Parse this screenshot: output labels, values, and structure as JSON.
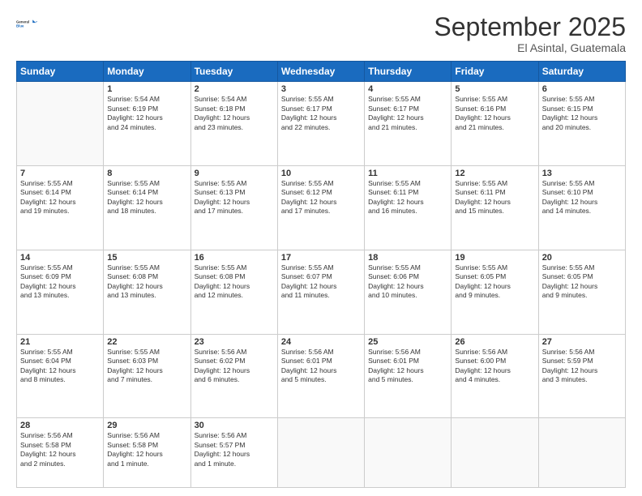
{
  "logo": {
    "line1": "General",
    "line2": "Blue"
  },
  "title": "September 2025",
  "location": "El Asintal, Guatemala",
  "days_of_week": [
    "Sunday",
    "Monday",
    "Tuesday",
    "Wednesday",
    "Thursday",
    "Friday",
    "Saturday"
  ],
  "weeks": [
    [
      {
        "day": "",
        "detail": ""
      },
      {
        "day": "1",
        "detail": "Sunrise: 5:54 AM\nSunset: 6:19 PM\nDaylight: 12 hours\nand 24 minutes."
      },
      {
        "day": "2",
        "detail": "Sunrise: 5:54 AM\nSunset: 6:18 PM\nDaylight: 12 hours\nand 23 minutes."
      },
      {
        "day": "3",
        "detail": "Sunrise: 5:55 AM\nSunset: 6:17 PM\nDaylight: 12 hours\nand 22 minutes."
      },
      {
        "day": "4",
        "detail": "Sunrise: 5:55 AM\nSunset: 6:17 PM\nDaylight: 12 hours\nand 21 minutes."
      },
      {
        "day": "5",
        "detail": "Sunrise: 5:55 AM\nSunset: 6:16 PM\nDaylight: 12 hours\nand 21 minutes."
      },
      {
        "day": "6",
        "detail": "Sunrise: 5:55 AM\nSunset: 6:15 PM\nDaylight: 12 hours\nand 20 minutes."
      }
    ],
    [
      {
        "day": "7",
        "detail": "Sunrise: 5:55 AM\nSunset: 6:14 PM\nDaylight: 12 hours\nand 19 minutes."
      },
      {
        "day": "8",
        "detail": "Sunrise: 5:55 AM\nSunset: 6:14 PM\nDaylight: 12 hours\nand 18 minutes."
      },
      {
        "day": "9",
        "detail": "Sunrise: 5:55 AM\nSunset: 6:13 PM\nDaylight: 12 hours\nand 17 minutes."
      },
      {
        "day": "10",
        "detail": "Sunrise: 5:55 AM\nSunset: 6:12 PM\nDaylight: 12 hours\nand 17 minutes."
      },
      {
        "day": "11",
        "detail": "Sunrise: 5:55 AM\nSunset: 6:11 PM\nDaylight: 12 hours\nand 16 minutes."
      },
      {
        "day": "12",
        "detail": "Sunrise: 5:55 AM\nSunset: 6:11 PM\nDaylight: 12 hours\nand 15 minutes."
      },
      {
        "day": "13",
        "detail": "Sunrise: 5:55 AM\nSunset: 6:10 PM\nDaylight: 12 hours\nand 14 minutes."
      }
    ],
    [
      {
        "day": "14",
        "detail": "Sunrise: 5:55 AM\nSunset: 6:09 PM\nDaylight: 12 hours\nand 13 minutes."
      },
      {
        "day": "15",
        "detail": "Sunrise: 5:55 AM\nSunset: 6:08 PM\nDaylight: 12 hours\nand 13 minutes."
      },
      {
        "day": "16",
        "detail": "Sunrise: 5:55 AM\nSunset: 6:08 PM\nDaylight: 12 hours\nand 12 minutes."
      },
      {
        "day": "17",
        "detail": "Sunrise: 5:55 AM\nSunset: 6:07 PM\nDaylight: 12 hours\nand 11 minutes."
      },
      {
        "day": "18",
        "detail": "Sunrise: 5:55 AM\nSunset: 6:06 PM\nDaylight: 12 hours\nand 10 minutes."
      },
      {
        "day": "19",
        "detail": "Sunrise: 5:55 AM\nSunset: 6:05 PM\nDaylight: 12 hours\nand 9 minutes."
      },
      {
        "day": "20",
        "detail": "Sunrise: 5:55 AM\nSunset: 6:05 PM\nDaylight: 12 hours\nand 9 minutes."
      }
    ],
    [
      {
        "day": "21",
        "detail": "Sunrise: 5:55 AM\nSunset: 6:04 PM\nDaylight: 12 hours\nand 8 minutes."
      },
      {
        "day": "22",
        "detail": "Sunrise: 5:55 AM\nSunset: 6:03 PM\nDaylight: 12 hours\nand 7 minutes."
      },
      {
        "day": "23",
        "detail": "Sunrise: 5:56 AM\nSunset: 6:02 PM\nDaylight: 12 hours\nand 6 minutes."
      },
      {
        "day": "24",
        "detail": "Sunrise: 5:56 AM\nSunset: 6:01 PM\nDaylight: 12 hours\nand 5 minutes."
      },
      {
        "day": "25",
        "detail": "Sunrise: 5:56 AM\nSunset: 6:01 PM\nDaylight: 12 hours\nand 5 minutes."
      },
      {
        "day": "26",
        "detail": "Sunrise: 5:56 AM\nSunset: 6:00 PM\nDaylight: 12 hours\nand 4 minutes."
      },
      {
        "day": "27",
        "detail": "Sunrise: 5:56 AM\nSunset: 5:59 PM\nDaylight: 12 hours\nand 3 minutes."
      }
    ],
    [
      {
        "day": "28",
        "detail": "Sunrise: 5:56 AM\nSunset: 5:58 PM\nDaylight: 12 hours\nand 2 minutes."
      },
      {
        "day": "29",
        "detail": "Sunrise: 5:56 AM\nSunset: 5:58 PM\nDaylight: 12 hours\nand 1 minute."
      },
      {
        "day": "30",
        "detail": "Sunrise: 5:56 AM\nSunset: 5:57 PM\nDaylight: 12 hours\nand 1 minute."
      },
      {
        "day": "",
        "detail": ""
      },
      {
        "day": "",
        "detail": ""
      },
      {
        "day": "",
        "detail": ""
      },
      {
        "day": "",
        "detail": ""
      }
    ]
  ]
}
